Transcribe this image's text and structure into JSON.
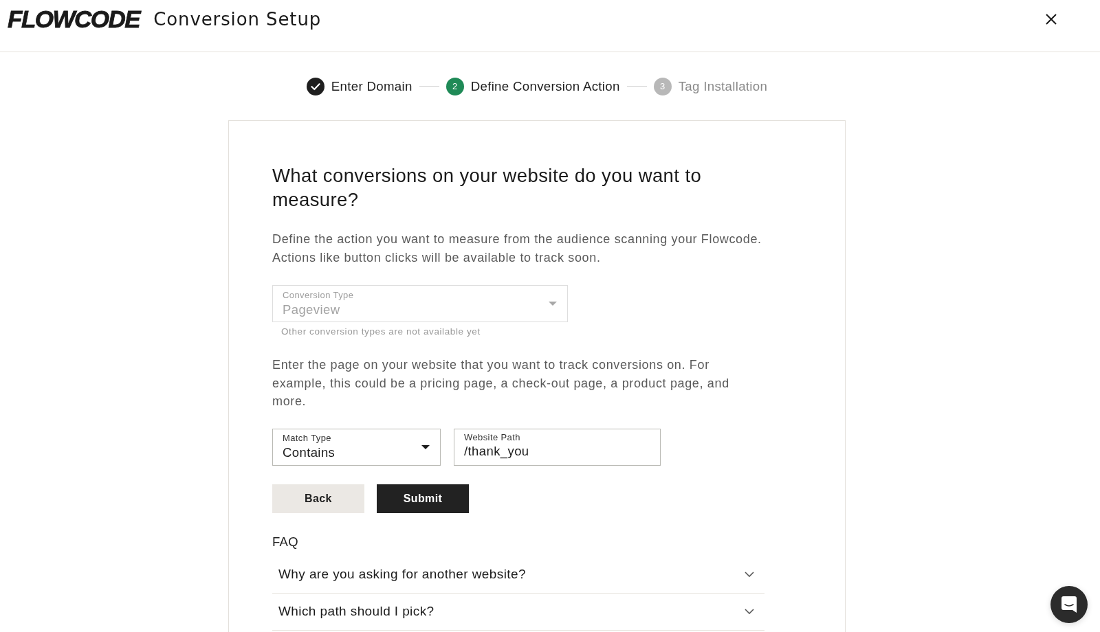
{
  "header": {
    "logo": "FLOWCODE",
    "title": "Conversion Setup"
  },
  "steps": [
    {
      "label": "Enter Domain",
      "done": true,
      "selected": false
    },
    {
      "number": "2",
      "label": "Define Conversion Action",
      "done": false,
      "selected": true
    },
    {
      "number": "3",
      "label": "Tag Installation",
      "done": false,
      "selected": false
    }
  ],
  "form": {
    "heading": "What conversions on your website do you want to measure?",
    "intro_lines": [
      "Define the action you want to measure from the audience scanning your Flowcode.",
      "Actions like button clicks will be available to track soon."
    ],
    "conversion_type": {
      "label": "Conversion Type",
      "value": "Pageview",
      "disabled": true,
      "helper": "Other conversion types are not available yet"
    },
    "path_intro_lines": [
      "Enter the page on your website that you want to track conversions on. For",
      "example, this could be a pricing page, a check-out page, a product page, and",
      "more."
    ],
    "fields": [
      {
        "kind": "select",
        "label": "Match Type",
        "value": "Contains",
        "disabled": false
      },
      {
        "kind": "text",
        "label": "Website Path",
        "value": "/thank_you"
      }
    ],
    "buttons": [
      {
        "label": "Back",
        "kind": "secondary"
      },
      {
        "label": "Submit",
        "kind": "primary"
      }
    ],
    "faq": {
      "title": "FAQ",
      "items": [
        {
          "question": "Why are you asking for another website?",
          "expanded": false
        },
        {
          "question": "Which path should I pick?",
          "expanded": false
        }
      ]
    }
  }
}
